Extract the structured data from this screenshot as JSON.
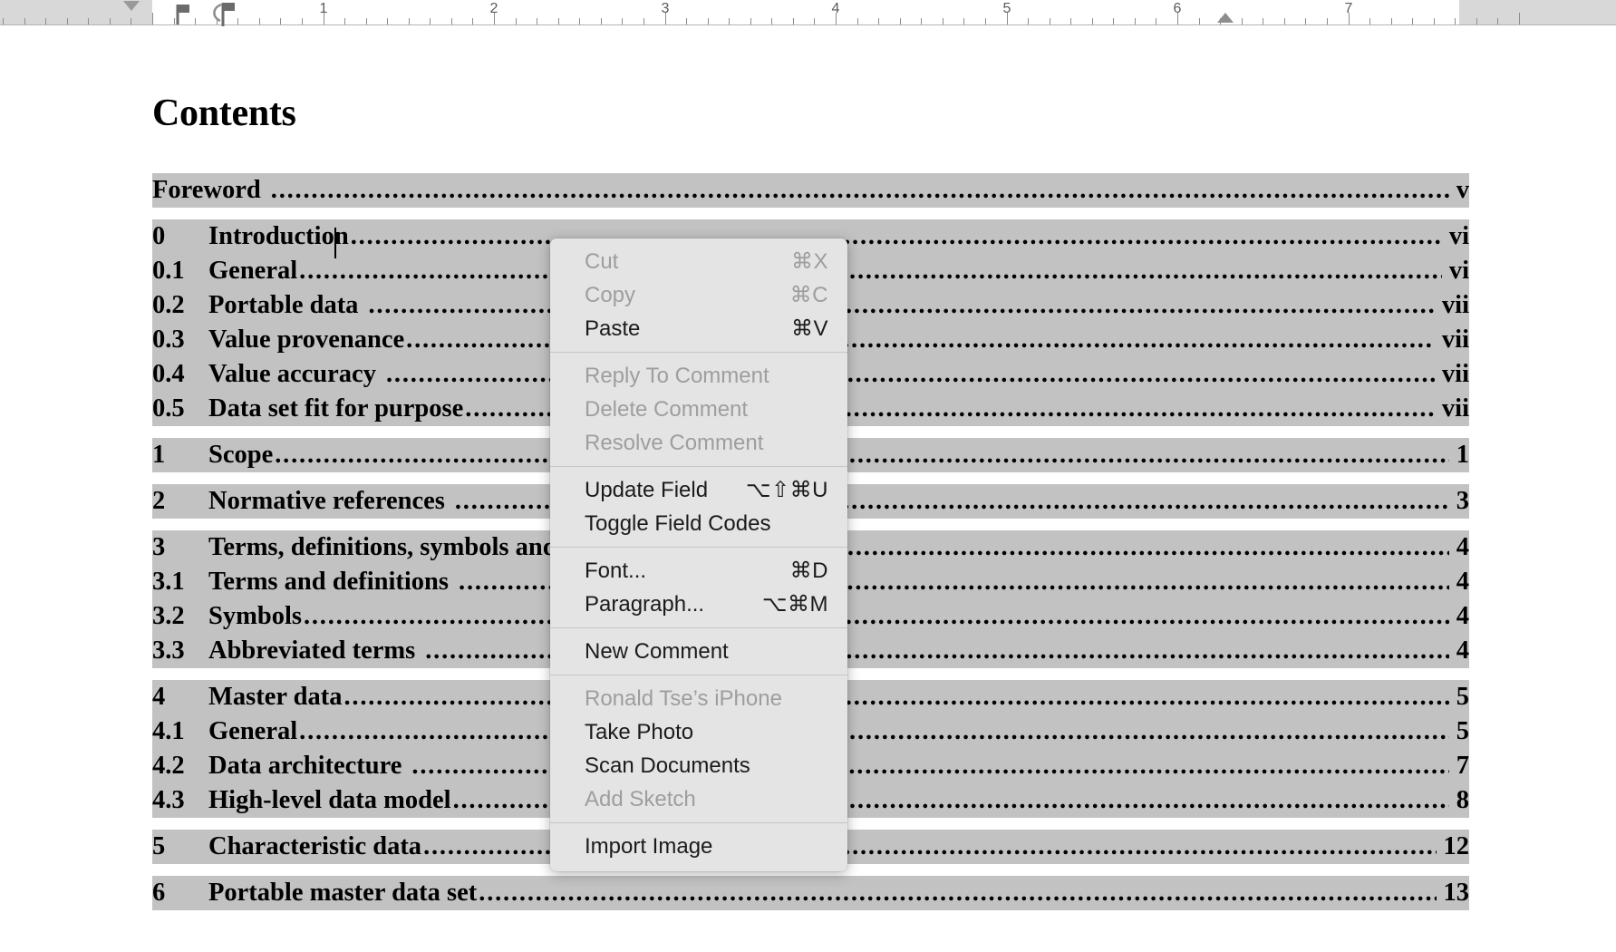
{
  "ruler": {
    "unit_labels": [
      "1",
      "2",
      "3",
      "4",
      "5",
      "6",
      "7"
    ],
    "markers": {
      "first_line_indent": "first-line-indent-marker",
      "right_indent": "right-indent-marker",
      "tab_stops": [
        "left-tab-stop",
        "left-tab-stop"
      ]
    }
  },
  "document": {
    "heading": "Contents",
    "caret_after": "Introduction",
    "toc_groups": [
      {
        "rows": [
          {
            "num": "",
            "title": "Foreword",
            "page": "v",
            "space_before_dots": true
          }
        ]
      },
      {
        "rows": [
          {
            "num": "0",
            "title": "Introduction",
            "page": "vi",
            "space_before_dots": false
          },
          {
            "num": "0.1",
            "title": "General",
            "page": "vi",
            "space_before_dots": false
          },
          {
            "num": "0.2",
            "title": "Portable data",
            "page": "vii",
            "space_before_dots": true
          },
          {
            "num": "0.3",
            "title": "Value provenance",
            "page": "vii",
            "space_before_dots": false
          },
          {
            "num": "0.4",
            "title": "Value accuracy",
            "page": "vii",
            "space_before_dots": true
          },
          {
            "num": "0.5",
            "title": "Data set fit for purpose",
            "page": "vii",
            "space_before_dots": false
          }
        ]
      },
      {
        "rows": [
          {
            "num": "1",
            "title": "Scope",
            "page": "1",
            "space_before_dots": false
          }
        ]
      },
      {
        "rows": [
          {
            "num": "2",
            "title": "Normative references",
            "page": "3",
            "space_before_dots": true
          }
        ]
      },
      {
        "rows": [
          {
            "num": "3",
            "title": "Terms, definitions, symbols and abbreviated terms",
            "page": "4",
            "space_before_dots": true
          },
          {
            "num": "3.1",
            "title": "Terms and definitions",
            "page": "4",
            "space_before_dots": true
          },
          {
            "num": "3.2",
            "title": "Symbols",
            "page": "4",
            "space_before_dots": false
          },
          {
            "num": "3.3",
            "title": "Abbreviated terms",
            "page": "4",
            "space_before_dots": true
          }
        ]
      },
      {
        "rows": [
          {
            "num": "4",
            "title": "Master data",
            "page": "5",
            "space_before_dots": false
          },
          {
            "num": "4.1",
            "title": "General",
            "page": "5",
            "space_before_dots": false
          },
          {
            "num": "4.2",
            "title": "Data architecture",
            "page": "7",
            "space_before_dots": true
          },
          {
            "num": "4.3",
            "title": "High-level data model",
            "page": "8",
            "space_before_dots": false
          }
        ]
      },
      {
        "rows": [
          {
            "num": "5",
            "title": "Characteristic data",
            "page": "12",
            "space_before_dots": false
          }
        ]
      },
      {
        "rows": [
          {
            "num": "6",
            "title": "Portable master data set",
            "page": "13",
            "space_before_dots": false
          }
        ]
      }
    ],
    "highlight_color": "#c2c2c2"
  },
  "context_menu": {
    "sections": [
      {
        "items": [
          {
            "label": "Cut",
            "shortcut": "⌘X",
            "disabled": true,
            "type": "item"
          },
          {
            "label": "Copy",
            "shortcut": "⌘C",
            "disabled": true,
            "type": "item"
          },
          {
            "label": "Paste",
            "shortcut": "⌘V",
            "disabled": false,
            "type": "item"
          }
        ]
      },
      {
        "items": [
          {
            "label": "Reply To Comment",
            "shortcut": "",
            "disabled": true,
            "type": "item"
          },
          {
            "label": "Delete Comment",
            "shortcut": "",
            "disabled": true,
            "type": "item"
          },
          {
            "label": "Resolve Comment",
            "shortcut": "",
            "disabled": true,
            "type": "item"
          }
        ]
      },
      {
        "items": [
          {
            "label": "Update Field",
            "shortcut": "⌥⇧⌘U",
            "disabled": false,
            "type": "item"
          },
          {
            "label": "Toggle Field Codes",
            "shortcut": "",
            "disabled": false,
            "type": "item"
          }
        ]
      },
      {
        "items": [
          {
            "label": "Font...",
            "shortcut": "⌘D",
            "disabled": false,
            "type": "item"
          },
          {
            "label": "Paragraph...",
            "shortcut": "⌥⌘M",
            "disabled": false,
            "type": "item"
          }
        ]
      },
      {
        "items": [
          {
            "label": "New Comment",
            "shortcut": "",
            "disabled": false,
            "type": "item"
          }
        ]
      },
      {
        "items": [
          {
            "label": "Ronald Tse’s iPhone",
            "shortcut": "",
            "disabled": true,
            "type": "header"
          },
          {
            "label": "Take Photo",
            "shortcut": "",
            "disabled": false,
            "type": "item"
          },
          {
            "label": "Scan Documents",
            "shortcut": "",
            "disabled": false,
            "type": "item"
          },
          {
            "label": "Add Sketch",
            "shortcut": "",
            "disabled": true,
            "type": "item"
          }
        ]
      },
      {
        "items": [
          {
            "label": "Import Image",
            "shortcut": "",
            "disabled": false,
            "type": "item"
          }
        ]
      }
    ]
  }
}
